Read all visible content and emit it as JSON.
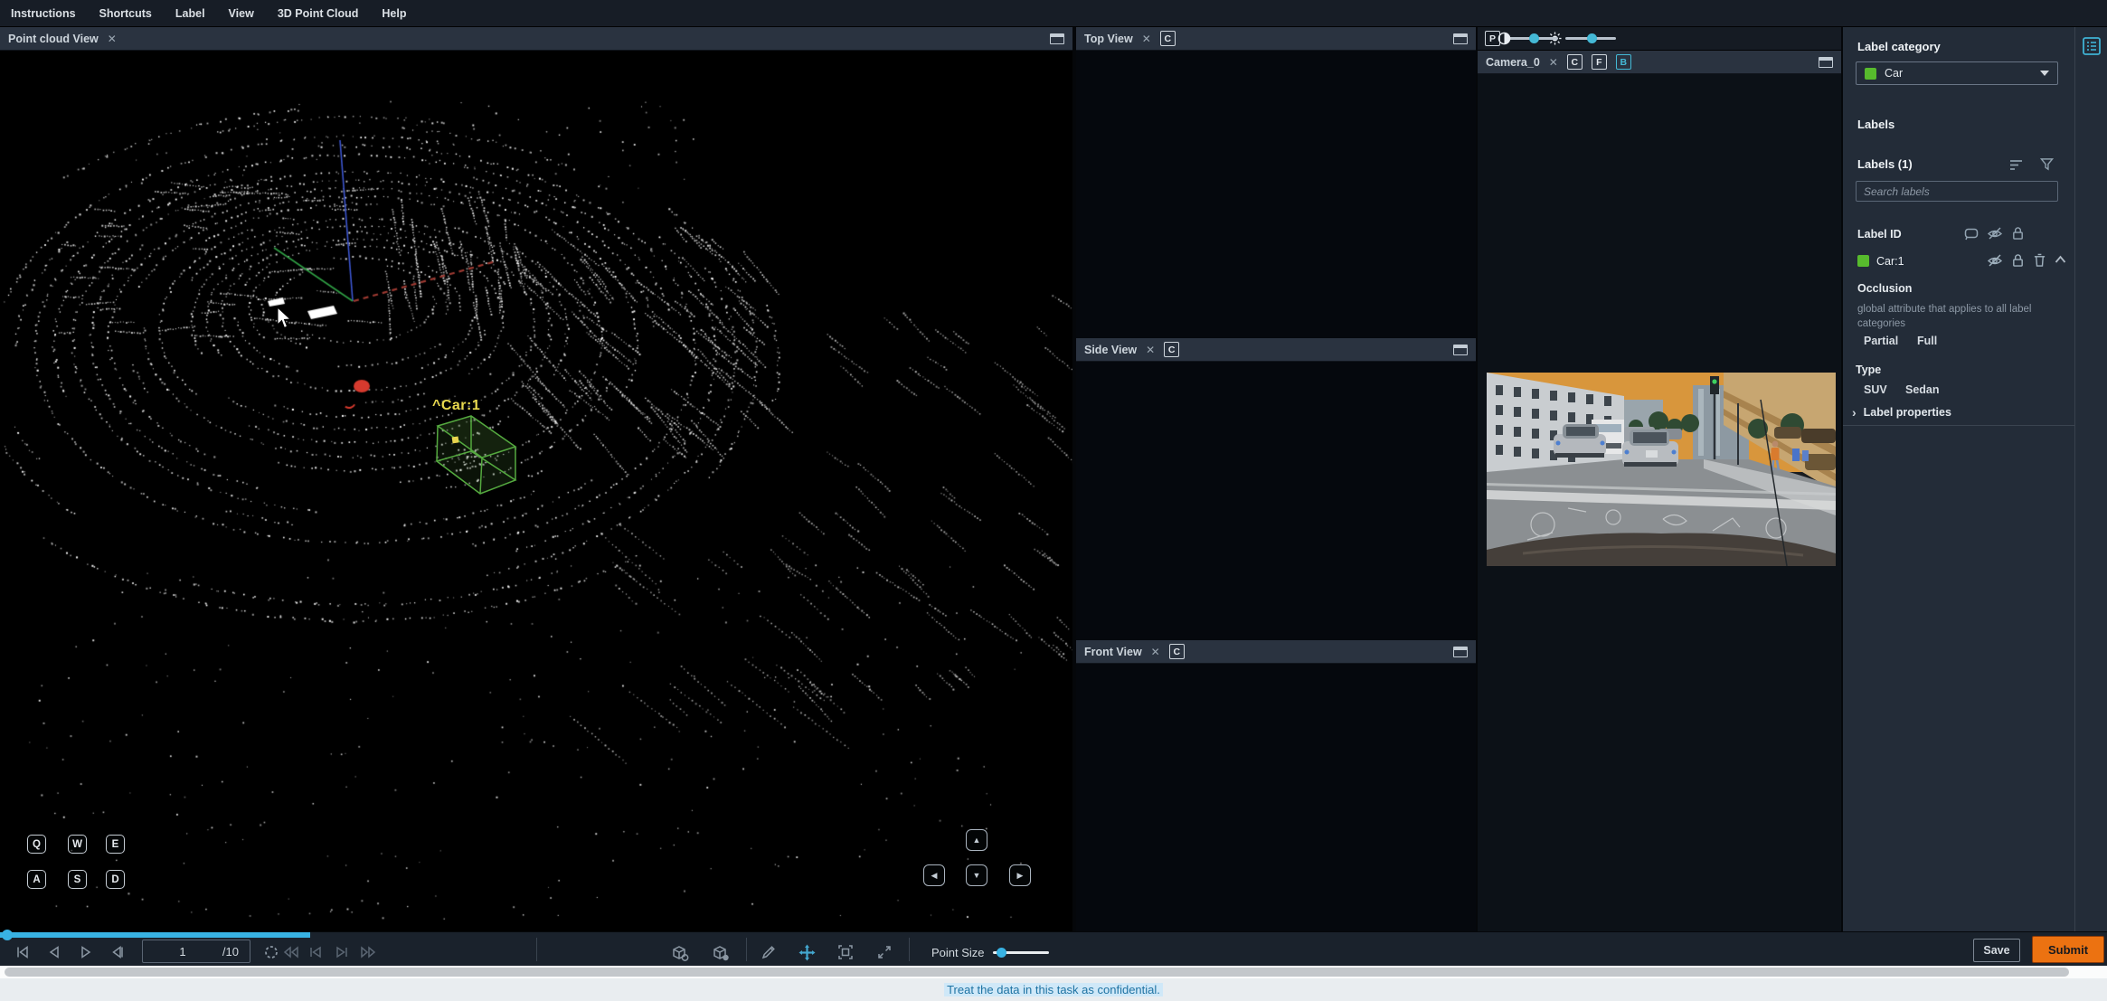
{
  "menu": {
    "items": [
      "Instructions",
      "Shortcuts",
      "Label",
      "View",
      "3D Point Cloud",
      "Help"
    ]
  },
  "panels": {
    "point_cloud": {
      "title": "Point cloud View"
    },
    "top_view": {
      "title": "Top View",
      "camera_btn": "C"
    },
    "side_view": {
      "title": "Side View",
      "camera_btn": "C"
    },
    "front_view": {
      "title": "Front View",
      "camera_btn": "C"
    },
    "camera": {
      "title": "Camera_0",
      "perspective_btn": "P",
      "btn_c": "C",
      "btn_f": "F",
      "btn_b": "B"
    }
  },
  "pointcloud": {
    "box_label": "^Car:1",
    "keys_row1": [
      "Q",
      "W",
      "E"
    ],
    "keys_row2": [
      "A",
      "S",
      "D"
    ]
  },
  "sidebar": {
    "label_category_heading": "Label category",
    "label_category_selected": "Car",
    "labels_heading": "Labels",
    "labels_count": "Labels (1)",
    "search_placeholder": "Search labels",
    "label_id_heading": "Label ID",
    "label_row_name": "Car:1",
    "occlusion_heading": "Occlusion",
    "occlusion_description": "global attribute that applies to all label categories",
    "occlusion_options": [
      "Partial",
      "Full"
    ],
    "type_heading": "Type",
    "type_options": [
      "SUV",
      "Sedan"
    ],
    "label_properties": "Label properties"
  },
  "toolbar": {
    "frame_current": "1",
    "frame_total": "/10",
    "point_size_label": "Point Size",
    "save_label": "Save",
    "submit_label": "Submit"
  },
  "footer": {
    "confidential_notice": "Treat the data in this task as confidential."
  },
  "ui": {
    "close_glyph": "✕",
    "chevron_right": "›"
  },
  "colors": {
    "accent_teal": "#44b9d6",
    "seek_blue": "#38b2e3",
    "label_green": "#57bb2d",
    "cuboid_green": "#54a93f",
    "label_yellow": "#e9d94f",
    "submit_orange": "#ec7211"
  }
}
